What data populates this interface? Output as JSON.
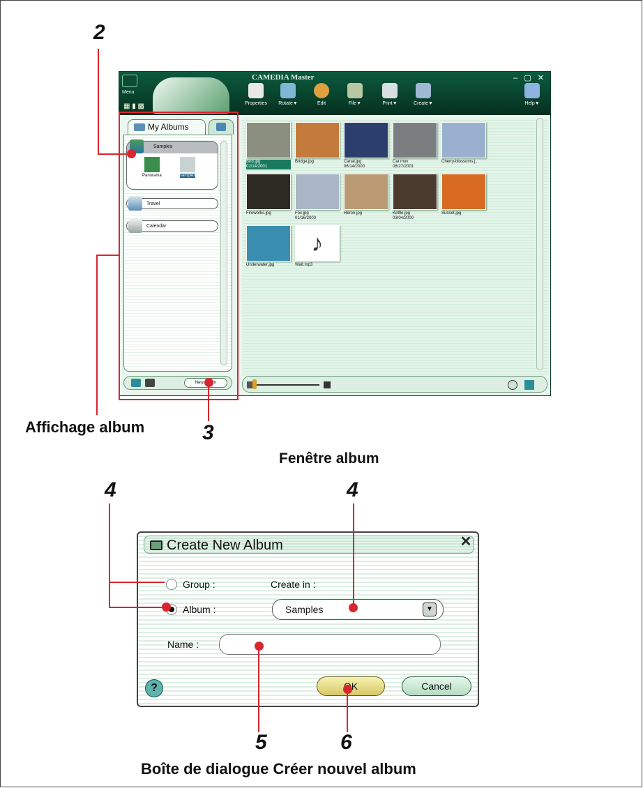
{
  "annotations": {
    "callout_2": "2",
    "callout_3": "3",
    "callout_4_left": "4",
    "callout_4_right": "4",
    "callout_5": "5",
    "callout_6": "6",
    "album_display_label": "Affichage album",
    "album_window_caption": "Fenêtre album",
    "dialog_caption": "Boîte de dialogue Créer nouvel album",
    "accent_color": "#d8262e"
  },
  "app": {
    "title": "CAMEDIA Master",
    "menu_label": "Menu",
    "window_controls": "– ▢ ✕",
    "toolbar": [
      {
        "label": "Properties",
        "icon": "properties-icon"
      },
      {
        "label": "Rotate▼",
        "icon": "rotate-icon"
      },
      {
        "label": "Edit",
        "icon": "edit-icon"
      },
      {
        "label": "File▼",
        "icon": "file-icon"
      },
      {
        "label": "Print▼",
        "icon": "print-icon"
      },
      {
        "label": "Create▼",
        "icon": "create-icon"
      },
      {
        "label": "Help▼",
        "icon": "help-icon"
      }
    ],
    "tabs": {
      "my_albums": "My Albums"
    },
    "albums": {
      "group_name": "Samples",
      "group_children": [
        "Panorama",
        "samples"
      ],
      "items": [
        "Travel",
        "Calendar"
      ]
    },
    "new_album_button": "New Album",
    "thumbnails": [
      {
        "name": "Bird.jpg",
        "date": "02/14/2001",
        "selected": true,
        "color": "#8a8f7f"
      },
      {
        "name": "Bridge.jpg",
        "date": "",
        "selected": false,
        "color": "#c47a3a"
      },
      {
        "name": "Canal.jpg",
        "date": "06/14/2000",
        "selected": false,
        "color": "#2b3f6e"
      },
      {
        "name": "Car.mov",
        "date": "08/27/2001",
        "selected": false,
        "color": "#7b7e80"
      },
      {
        "name": "Cherry-blossoms.j...",
        "date": "",
        "selected": false,
        "color": "#9ab0cf"
      },
      {
        "name": "Fireworks.jpg",
        "date": "",
        "selected": false,
        "color": "#2c2a22"
      },
      {
        "name": "Fox.jpg",
        "date": "01/16/2000",
        "selected": false,
        "color": "#a9b6c6"
      },
      {
        "name": "Heron.jpg",
        "date": "",
        "selected": false,
        "color": "#b99a72"
      },
      {
        "name": "Kettle.jpg",
        "date": "03/04/2000",
        "selected": false,
        "color": "#4b3a2e"
      },
      {
        "name": "Sunset.jpg",
        "date": "",
        "selected": false,
        "color": "#d86a22"
      },
      {
        "name": "Underwater.jpg",
        "date": "",
        "selected": false,
        "color": "#3a8fb0"
      },
      {
        "name": "Wait.mp3",
        "date": "",
        "selected": false,
        "color": "#ffffff"
      }
    ]
  },
  "dialog": {
    "title": "Create New Album",
    "close_glyph": "✕",
    "group_label": "Group :",
    "album_label": "Album :",
    "selected_type": "Album",
    "create_in_label": "Create in :",
    "create_in_value": "Samples",
    "name_label": "Name :",
    "name_value": "",
    "ok_label": "OK",
    "cancel_label": "Cancel",
    "help_glyph": "?"
  }
}
